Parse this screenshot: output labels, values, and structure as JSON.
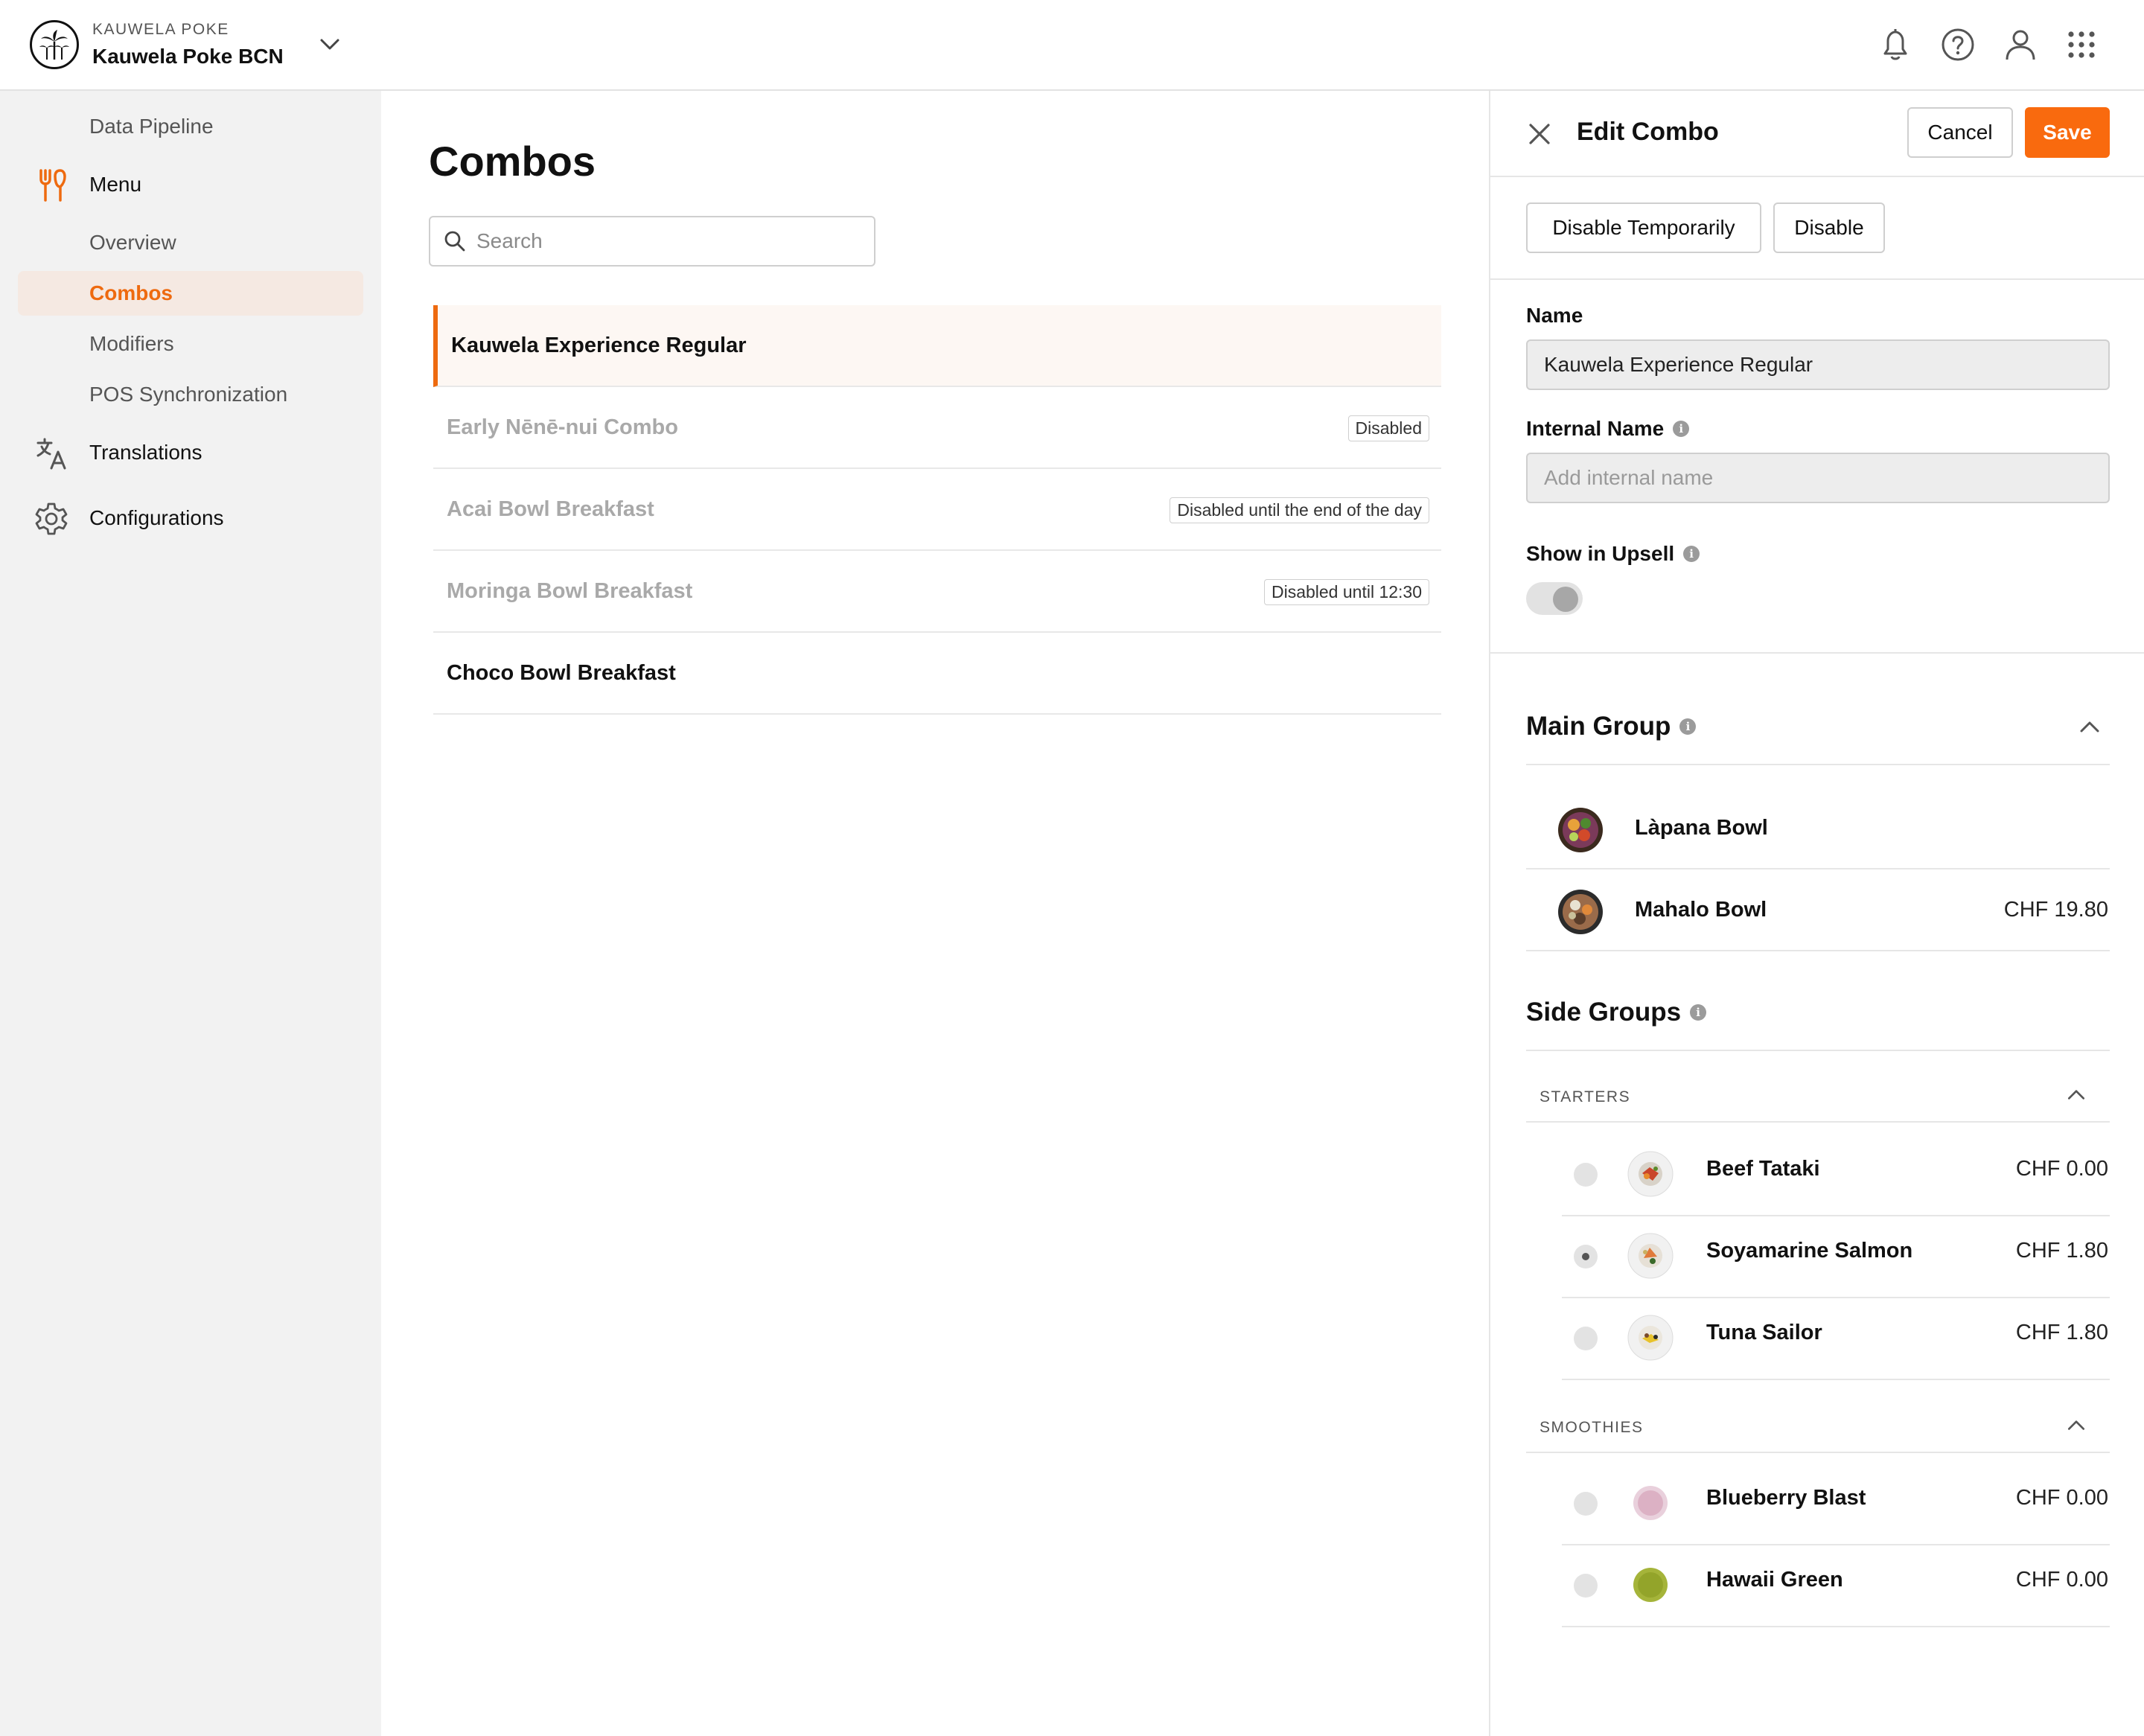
{
  "header": {
    "company": "KAUWELA POKE",
    "location": "Kauwela Poke BCN"
  },
  "sidebar": {
    "items": [
      {
        "label": "Data Pipeline"
      },
      {
        "label": "Menu",
        "icon": "fork-knife-icon"
      },
      {
        "label": "Overview"
      },
      {
        "label": "Combos",
        "active": true
      },
      {
        "label": "Modifiers"
      },
      {
        "label": "POS Synchronization"
      },
      {
        "label": "Translations",
        "icon": "translate-icon"
      },
      {
        "label": "Configurations",
        "icon": "gear-icon"
      }
    ]
  },
  "main": {
    "title": "Combos",
    "search_placeholder": "Search",
    "combos": [
      {
        "name": "Kauwela Experience Regular",
        "badge": "",
        "selected": true
      },
      {
        "name": "Early Nēnē-nui Combo",
        "badge": "Disabled"
      },
      {
        "name": "Acai Bowl Breakfast",
        "badge": "Disabled until the end of the day"
      },
      {
        "name": "Moringa Bowl Breakfast",
        "badge": "Disabled until 12:30"
      },
      {
        "name": "Choco Bowl Breakfast",
        "badge": ""
      }
    ]
  },
  "panel": {
    "title": "Edit Combo",
    "cancel_label": "Cancel",
    "save_label": "Save",
    "disable_temp_label": "Disable Temporarily",
    "disable_label": "Disable",
    "name_label": "Name",
    "name_value": "Kauwela Experience Regular",
    "internal_name_label": "Internal Name",
    "internal_name_placeholder": "Add internal name",
    "upsell_label": "Show in Upsell",
    "upsell_enabled": false,
    "main_group": {
      "title": "Main Group",
      "items": [
        {
          "name": "Làpana Bowl",
          "price": ""
        },
        {
          "name": "Mahalo Bowl",
          "price": "CHF 19.80"
        }
      ]
    },
    "side_groups": {
      "title": "Side Groups",
      "groups": [
        {
          "label": "STARTERS",
          "items": [
            {
              "name": "Beef Tataki",
              "price": "CHF 0.00",
              "checked": false
            },
            {
              "name": "Soyamarine Salmon",
              "price": "CHF 1.80",
              "checked": true
            },
            {
              "name": "Tuna Sailor",
              "price": "CHF 1.80",
              "checked": false
            }
          ]
        },
        {
          "label": "SMOOTHIES",
          "items": [
            {
              "name": "Blueberry Blast",
              "price": "CHF 0.00",
              "checked": false
            },
            {
              "name": "Hawaii Green",
              "price": "CHF 0.00",
              "checked": false
            }
          ]
        }
      ]
    }
  },
  "colors": {
    "accent": "#f96a0e",
    "active_bg": "#f5e9e2",
    "sidebar_bg": "#f2f2f2"
  }
}
